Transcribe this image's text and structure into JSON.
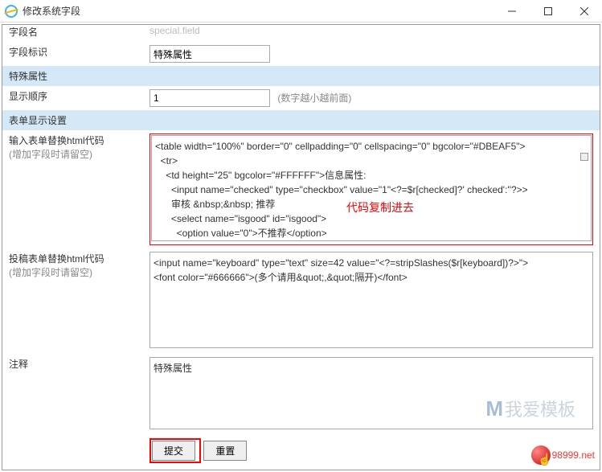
{
  "window": {
    "title": "修改系统字段"
  },
  "rows": {
    "r0_label": "字段名",
    "r0_value_ghost": "special.field",
    "r1_label": "字段标识",
    "r1_value": "特殊属性",
    "section1": "特殊属性",
    "r2_label": "显示顺序",
    "r2_value": "1",
    "r2_hint": "(数字越小越前面)",
    "section2": "表单显示设置",
    "r3_label": "输入表单替换html代码",
    "r3_sub": "(增加字段时请留空)",
    "r3_overlay": "代码复制进去",
    "r3_text": "<table width=\"100%\" border=\"0\" cellpadding=\"0\" cellspacing=\"0\" bgcolor=\"#DBEAF5\">\n  <tr>\n    <td height=\"25\" bgcolor=\"#FFFFFF\">信息属性:\n      <input name=\"checked\" type=\"checkbox\" value=\"1\"<?=$r[checked]?' checked':''?>>\n      审核 &nbsp;&nbsp; 推荐\n      <select name=\"isgood\" id=\"isgood\">\n        <option value=\"0\">不推荐</option>\n        <?=$ftnr['igname']?>\n      </select>",
    "r4_label": "投稿表单替换html代码",
    "r4_sub": "(增加字段时请留空)",
    "r4_text": "<input name=\"keyboard\" type=\"text\" size=42 value=\"<?=stripSlashes($r[keyboard])?>\">\n<font color=\"#666666\">(多个请用&quot;,&quot;隔开)</font>",
    "r5_label": "注释",
    "r5_value": "特殊属性",
    "btn_submit": "提交",
    "btn_reset": "重置"
  },
  "watermark": {
    "text": "我爱模板",
    "site": "98999.net"
  }
}
